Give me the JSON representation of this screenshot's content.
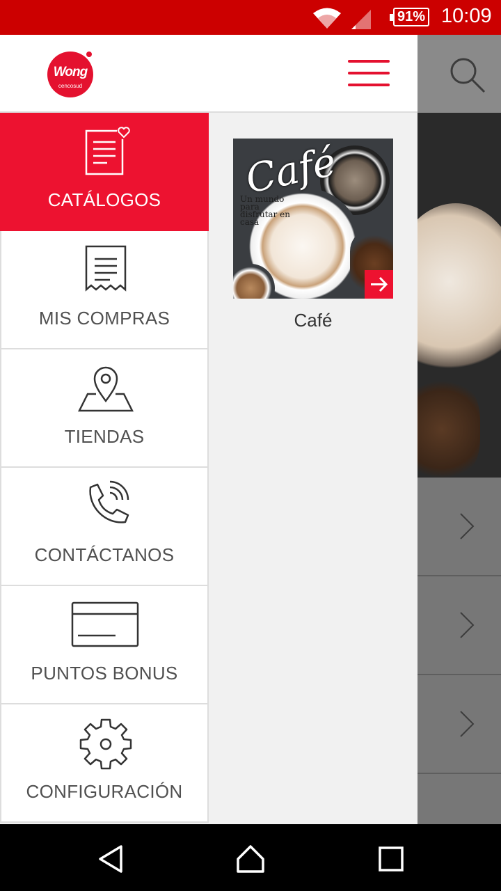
{
  "status_bar": {
    "battery": "91%",
    "time": "10:09"
  },
  "colors": {
    "brand_red": "#ed1230",
    "status_red": "#cc0000"
  },
  "header": {
    "logo_text": "Wong",
    "logo_subtext": "cencosud"
  },
  "menu": {
    "items": [
      {
        "label": "CATÁLOGOS",
        "icon": "catalog-heart-icon",
        "active": true
      },
      {
        "label": "MIS COMPRAS",
        "icon": "receipt-icon",
        "active": false
      },
      {
        "label": "TIENDAS",
        "icon": "map-pin-icon",
        "active": false
      },
      {
        "label": "CONTÁCTANOS",
        "icon": "phone-icon",
        "active": false
      },
      {
        "label": "PUNTOS BONUS",
        "icon": "credit-card-icon",
        "active": false
      },
      {
        "label": "CONFIGURACIÓN",
        "icon": "gear-icon",
        "active": false
      }
    ]
  },
  "catalogs": [
    {
      "title": "Café",
      "image_script": "Café",
      "image_tagline": "Un mundo para disfrutar en casa"
    }
  ]
}
